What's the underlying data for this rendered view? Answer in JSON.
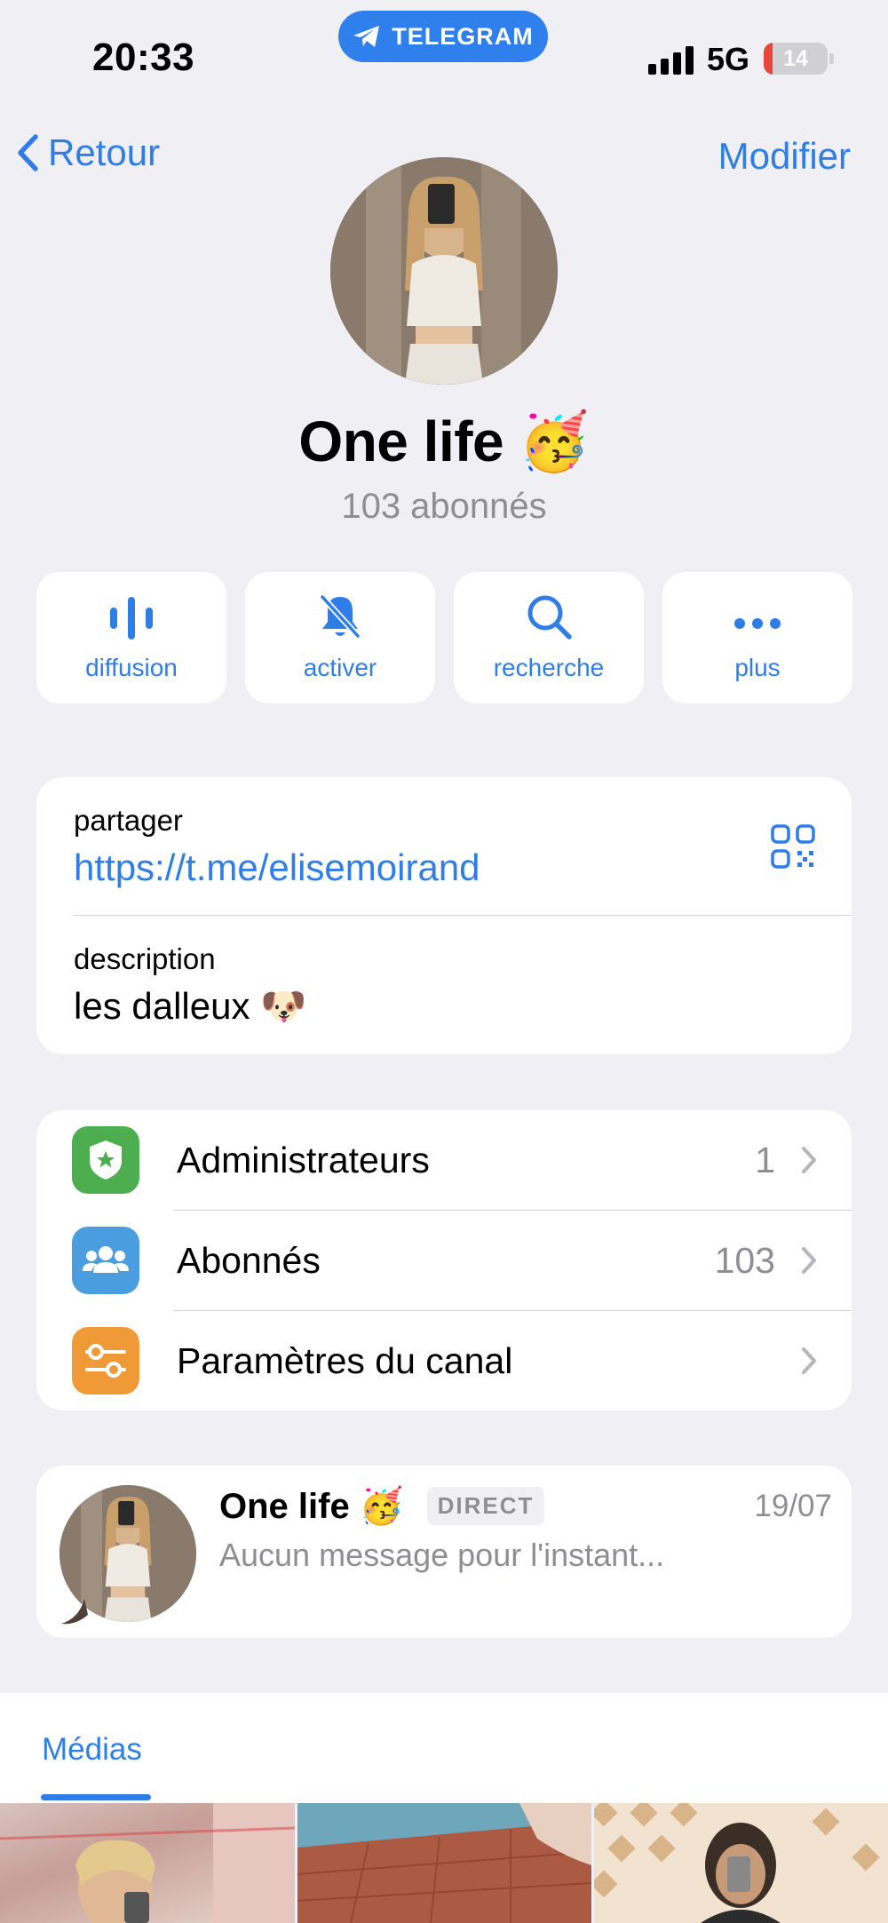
{
  "status_bar": {
    "time": "20:33",
    "app_pill": "TELEGRAM",
    "network": "5G",
    "battery": "14",
    "battery_level": 0.14
  },
  "nav": {
    "back_label": "Retour",
    "edit_label": "Modifier"
  },
  "profile": {
    "name": "One life 🥳",
    "subscribers": "103 abonnés"
  },
  "actions": [
    {
      "label": "diffusion",
      "icon": "broadcast-icon"
    },
    {
      "label": "activer",
      "icon": "bell-muted-icon"
    },
    {
      "label": "recherche",
      "icon": "search-icon"
    },
    {
      "label": "plus",
      "icon": "more-icon"
    }
  ],
  "info": {
    "share_label": "partager",
    "share_link": "https://t.me/elisemoirand",
    "description_label": "description",
    "description": "les dalleux 🐶"
  },
  "settings": [
    {
      "label": "Administrateurs",
      "value": "1",
      "icon": "admin-shield-icon",
      "color": "#4cae4f"
    },
    {
      "label": "Abonnés",
      "value": "103",
      "icon": "people-icon",
      "color": "#4a9ee0"
    },
    {
      "label": "Paramètres du canal",
      "value": "",
      "icon": "sliders-icon",
      "color": "#f09a37"
    }
  ],
  "chat": {
    "title": "One life 🥳",
    "badge": "DIRECT",
    "date": "19/07",
    "preview": "Aucun message pour l'instant..."
  },
  "media": {
    "tab_label": "Médias"
  },
  "colors": {
    "accent": "#2f7ee8",
    "background": "#efeff4",
    "secondary_text": "#8e8e93"
  }
}
